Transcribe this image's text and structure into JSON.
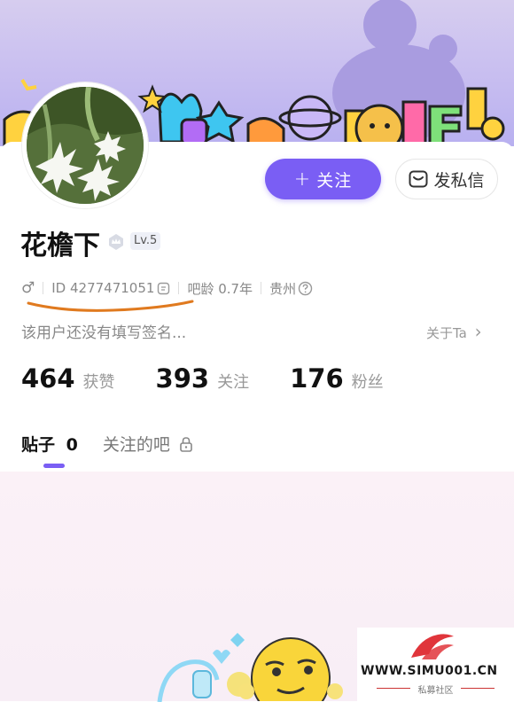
{
  "profile": {
    "username": "花檐下",
    "level": "Lv.5",
    "follow_label": "关注",
    "follow_plus": "+",
    "message_label": "发私信",
    "gender_symbol": "♂",
    "id_text": "ID 4277471051",
    "bar_age": "吧龄 0.7年",
    "location": "贵州",
    "signature": "该用户还没有填写签名...",
    "about_label": "关于Ta",
    "about_chevron": "›"
  },
  "stats": [
    {
      "value": "464",
      "label": "获赞"
    },
    {
      "value": "393",
      "label": "关注"
    },
    {
      "value": "176",
      "label": "粉丝"
    }
  ],
  "tabs": {
    "posts_label": "贴子",
    "posts_count": "0",
    "followed_bars_label": "关注的吧"
  },
  "watermark": {
    "site": "WWW.SIMU001.CN",
    "sub": "私募社区"
  },
  "colors": {
    "accent": "#7a5ef4",
    "underline": "#e07a1f"
  },
  "icons": [
    "gender-male-icon",
    "copy-icon",
    "help-circle-icon",
    "chevron-right-icon",
    "lock-icon",
    "message-icon",
    "crown-badge-icon"
  ]
}
